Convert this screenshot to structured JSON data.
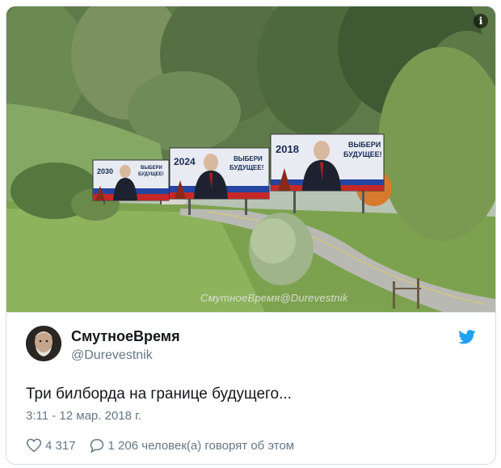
{
  "photo": {
    "watermark": "СмутноеВремя@Durevestnik",
    "info_icon": "info-icon",
    "billboards": [
      {
        "year": "2030",
        "slogan_line1": "ВЫБЕРИ",
        "slogan_line2": "БУДУЩЕЕ!"
      },
      {
        "year": "2024",
        "slogan_line1": "ВЫБЕРИ",
        "slogan_line2": "БУДУЩЕЕ!"
      },
      {
        "year": "2018",
        "slogan_line1": "ВЫБЕРИ",
        "slogan_line2": "БУДУЩЕЕ!"
      }
    ]
  },
  "tweet": {
    "display_name": "СмутноеВремя",
    "handle": "@Durevestnik",
    "text": "Три билборда на границе будущего...",
    "timestamp": "3:11 - 12 мар. 2018 г.",
    "likes": "4 317",
    "replies": "1 206 человек(а) говорят об этом",
    "brand_color": "#1da1f2"
  }
}
